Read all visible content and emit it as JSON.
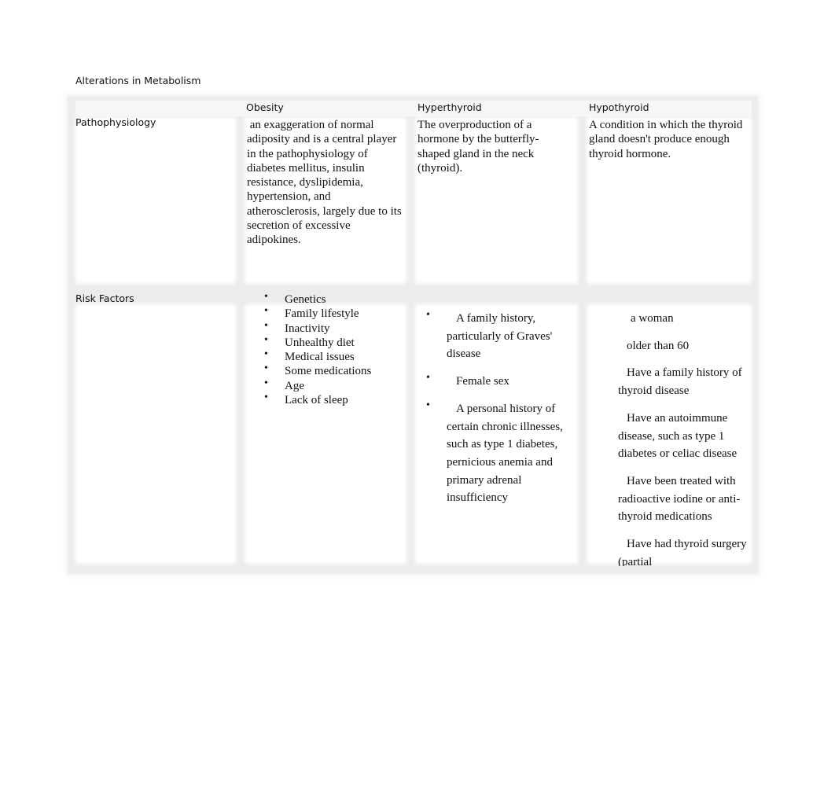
{
  "title": "Alterations in Metabolism",
  "columns": [
    "Obesity",
    "Hyperthyroid",
    "Hypothyroid"
  ],
  "rows": {
    "pathophysiology": {
      "label": "Pathophysiology",
      "obesity": " an exaggeration of normal adiposity and is a central player in the pathophysiology of diabetes mellitus, insulin resistance, dyslipidemia, hypertension, and atherosclerosis, largely due to its secretion of excessive adipokines.",
      "hyperthyroid": "The overproduction of a hormone by the butterfly-shaped gland in the neck (thyroid).",
      "hypothyroid": "A condition in which the thyroid gland doesn't produce enough thyroid hormone."
    },
    "risk_factors": {
      "label": "Risk Factors",
      "obesity": [
        "Genetics",
        "Family lifestyle",
        "Inactivity",
        "Unhealthy diet",
        "Medical issues",
        "Some medications",
        "Age",
        "Lack of sleep"
      ],
      "hyperthyroid": [
        "A family history, particularly of Graves' disease",
        "Female sex",
        "A personal history of certain chronic illnesses, such as type 1 diabetes, pernicious anemia and primary adrenal insufficiency"
      ],
      "hypothyroid": [
        "a woman",
        "older than 60",
        "Have a family history of thyroid disease",
        "Have an autoimmune disease, such as type 1 diabetes or celiac disease",
        "Have been treated with radioactive iodine or anti-thyroid medications",
        "Have had thyroid surgery (partial"
      ]
    }
  },
  "bullet": "•"
}
